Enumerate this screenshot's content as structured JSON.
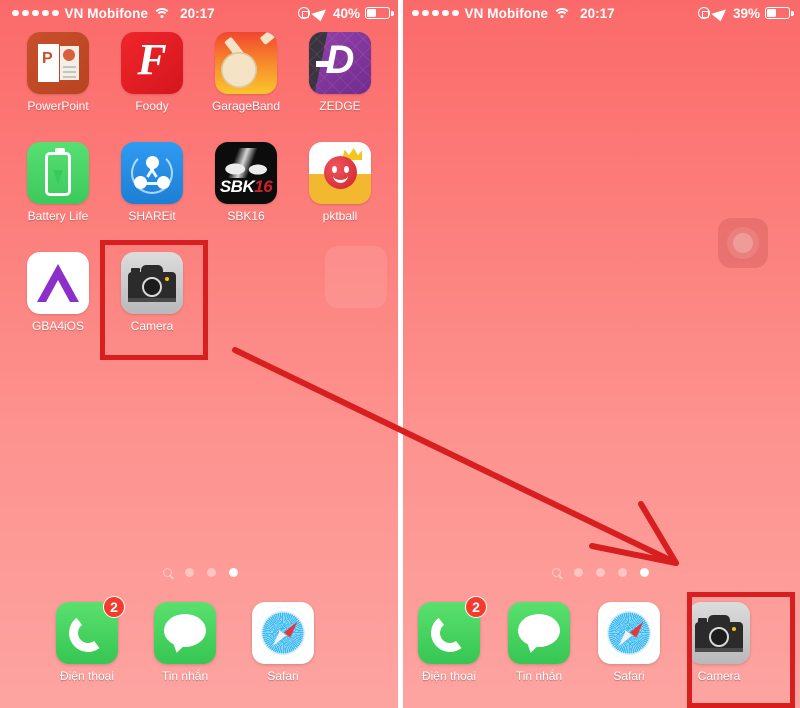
{
  "screen": {
    "left_panel": {
      "status_bar": {
        "signal_dots": 5,
        "carrier": "VN Mobifone",
        "wifi_icon": "wifi-icon",
        "time": "20:17",
        "lock_icon": "rotation-lock-icon",
        "location_icon": "location-arrow-icon",
        "battery_percent": "40%",
        "battery_level": 40
      },
      "apps": [
        {
          "label": "PowerPoint",
          "icon": "powerpoint-icon"
        },
        {
          "label": "Foody",
          "icon": "foody-icon"
        },
        {
          "label": "GarageBand",
          "icon": "garageband-icon"
        },
        {
          "label": "ZEDGE",
          "icon": "zedge-icon"
        },
        {
          "label": "Battery Life",
          "icon": "battery-life-icon"
        },
        {
          "label": "SHAREit",
          "icon": "shareit-icon"
        },
        {
          "label": "SBK16",
          "icon": "sbk16-icon"
        },
        {
          "label": "pktball",
          "icon": "pktball-icon"
        },
        {
          "label": "GBA4iOS",
          "icon": "gba4ios-icon"
        },
        {
          "label": "Camera",
          "icon": "camera-icon"
        }
      ],
      "page_dots": {
        "search_icon": "search-icon",
        "count": 3,
        "active_index": 2
      },
      "dock": [
        {
          "label": "Điện thoại",
          "icon": "phone-icon",
          "badge": "2"
        },
        {
          "label": "Tin nhắn",
          "icon": "messages-icon",
          "badge": ""
        },
        {
          "label": "Safari",
          "icon": "safari-icon",
          "badge": ""
        }
      ]
    },
    "right_panel": {
      "status_bar": {
        "signal_dots": 5,
        "carrier": "VN Mobifone",
        "wifi_icon": "wifi-icon",
        "time": "20:17",
        "lock_icon": "rotation-lock-icon",
        "location_icon": "location-arrow-icon",
        "battery_percent": "39%",
        "battery_level": 39
      },
      "apps": [],
      "page_dots": {
        "search_icon": "search-icon",
        "count": 4,
        "active_index": 3
      },
      "dock": [
        {
          "label": "Điện thoại",
          "icon": "phone-icon",
          "badge": "2"
        },
        {
          "label": "Tin nhắn",
          "icon": "messages-icon",
          "badge": ""
        },
        {
          "label": "Safari",
          "icon": "safari-icon",
          "badge": ""
        },
        {
          "label": "Camera",
          "icon": "camera-icon",
          "badge": ""
        }
      ]
    }
  },
  "annotations": {
    "highlight_color": "#d81f20",
    "arrow_color": "#d81f20",
    "boxes": [
      {
        "name": "camera-highlight-left",
        "target": "Camera"
      },
      {
        "name": "camera-highlight-right",
        "target": "Camera"
      }
    ],
    "arrow": {
      "name": "drag-arrow",
      "from": "Camera app icon on home screen",
      "to": "Camera in dock"
    }
  },
  "theme": {
    "wallpaper_top": "#fb6a6a",
    "wallpaper_bottom": "#fda4a1",
    "divider": "#ffffff",
    "badge_color": "#f53b2e",
    "label_color": "#ffffff"
  }
}
